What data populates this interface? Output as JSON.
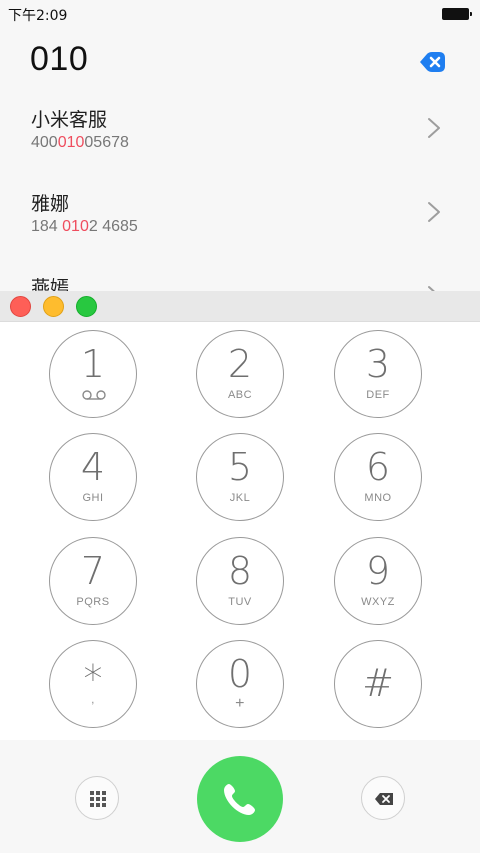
{
  "status_bar": {
    "time": "下午2:09"
  },
  "dialer": {
    "typed_number": "010",
    "clear_icon": "clear-circle-icon"
  },
  "contacts": [
    {
      "name": "小米客服",
      "number_pre": "400",
      "number_match": "010",
      "number_post": "05678"
    },
    {
      "name": "雅娜",
      "number_pre": "184 ",
      "number_match": "010",
      "number_post": "2 4685"
    },
    {
      "name": "燕嫣",
      "number_pre": "",
      "number_match": "",
      "number_post": ""
    }
  ],
  "keypad": {
    "keys": [
      {
        "digit": "1",
        "letters": ""
      },
      {
        "digit": "2",
        "letters": "ABC"
      },
      {
        "digit": "3",
        "letters": "DEF"
      },
      {
        "digit": "4",
        "letters": "GHI"
      },
      {
        "digit": "5",
        "letters": "JKL"
      },
      {
        "digit": "6",
        "letters": "MNO"
      },
      {
        "digit": "7",
        "letters": "PQRS"
      },
      {
        "digit": "8",
        "letters": "TUV"
      },
      {
        "digit": "9",
        "letters": "WXYZ"
      },
      {
        "digit": "*",
        "letters": ","
      },
      {
        "digit": "0",
        "letters": "+"
      },
      {
        "digit": "#",
        "letters": ""
      }
    ],
    "voicemail_icon": "voicemail-icon"
  },
  "actions": {
    "keypad_toggle_icon": "grid-icon",
    "call_icon": "phone-icon",
    "backspace_icon": "backspace-icon"
  },
  "colors": {
    "highlight": "#ef4d5e",
    "call_green": "#4cd964",
    "clear_blue": "#1f7ef0"
  }
}
